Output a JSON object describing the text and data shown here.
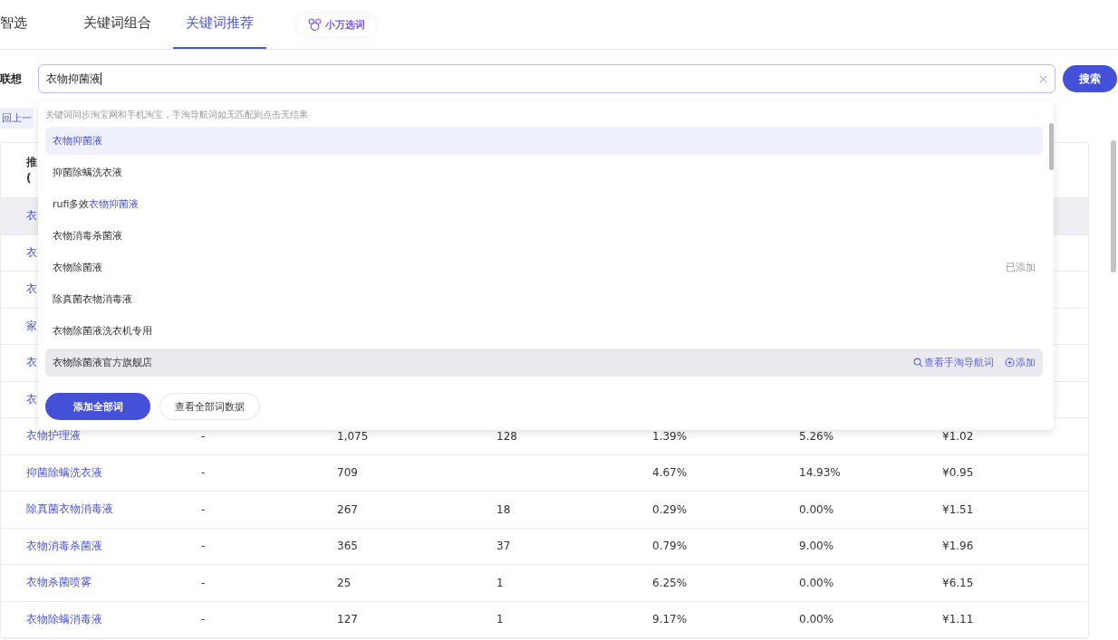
{
  "tabs": [
    {
      "label": "智选",
      "selected": false
    },
    {
      "label": "关键词组合",
      "selected": false
    },
    {
      "label": "关键词推荐",
      "selected": true
    }
  ],
  "badge": {
    "label": "小万选词"
  },
  "search": {
    "label": "联想",
    "value": "衣物抑菌液",
    "button": "搜索"
  },
  "back_link": "回上一",
  "dropdown": {
    "hint": "关键词同步淘宝网和手机淘宝，手淘导航词如无匹配则点击无结果",
    "items": [
      {
        "text": "衣物抑菌液",
        "selected": true,
        "hovered": false
      },
      {
        "text": "抑菌除螨洗衣液",
        "selected": false,
        "hovered": false
      },
      {
        "text": "rufi多效",
        "match": "衣物抑菌液",
        "selected": false,
        "hovered": false
      },
      {
        "text": "衣物消毒杀菌液",
        "selected": false,
        "hovered": false
      },
      {
        "text": "衣物除菌液",
        "selected": false,
        "hovered": false,
        "status": "已添加"
      },
      {
        "text": "除真菌衣物消毒液",
        "selected": false,
        "hovered": false
      },
      {
        "text": "衣物除菌液洗衣机专用",
        "selected": false,
        "hovered": false
      },
      {
        "text": "衣物除菌液官方旗舰店",
        "selected": false,
        "hovered": true,
        "actions": [
          "查看手淘导航词",
          "添加"
        ]
      }
    ],
    "buttons": [
      "添加全部词",
      "查看全部词数据"
    ]
  },
  "table": {
    "header": [
      "推",
      "("
    ],
    "rows": [
      {
        "cells": [
          "衣"
        ],
        "highlighted": true
      },
      {
        "cells": [
          "衣"
        ],
        "highlighted": false
      },
      {
        "cells": [
          "衣"
        ],
        "highlighted": false
      },
      {
        "cells": [
          "家"
        ],
        "highlighted": false
      },
      {
        "cells": [
          "衣"
        ],
        "highlighted": false
      },
      {
        "cells": [
          "衣"
        ],
        "highlighted": false
      },
      {
        "cells": [
          "衣物护理液",
          "-",
          "1,075",
          "128",
          "1.39%",
          "5.26%",
          "¥1.02"
        ],
        "highlighted": false
      },
      {
        "cells": [
          "抑菌除螨洗衣液",
          "-",
          "709",
          "",
          "4.67%",
          "14.93%",
          "¥0.95"
        ],
        "highlighted": false
      },
      {
        "cells": [
          "除真菌衣物消毒液",
          "-",
          "267",
          "18",
          "0.29%",
          "0.00%",
          "¥1.51"
        ],
        "highlighted": false
      },
      {
        "cells": [
          "衣物消毒杀菌液",
          "-",
          "365",
          "37",
          "0.79%",
          "9.00%",
          "¥1.96"
        ],
        "highlighted": false
      },
      {
        "cells": [
          "衣物杀菌喷雾",
          "-",
          "25",
          "1",
          "6.25%",
          "0.00%",
          "¥6.15"
        ],
        "highlighted": false
      },
      {
        "cells": [
          "衣物除螨消毒液",
          "-",
          "127",
          "1",
          "9.17%",
          "0.00%",
          "¥1.11"
        ],
        "highlighted": false
      }
    ]
  }
}
